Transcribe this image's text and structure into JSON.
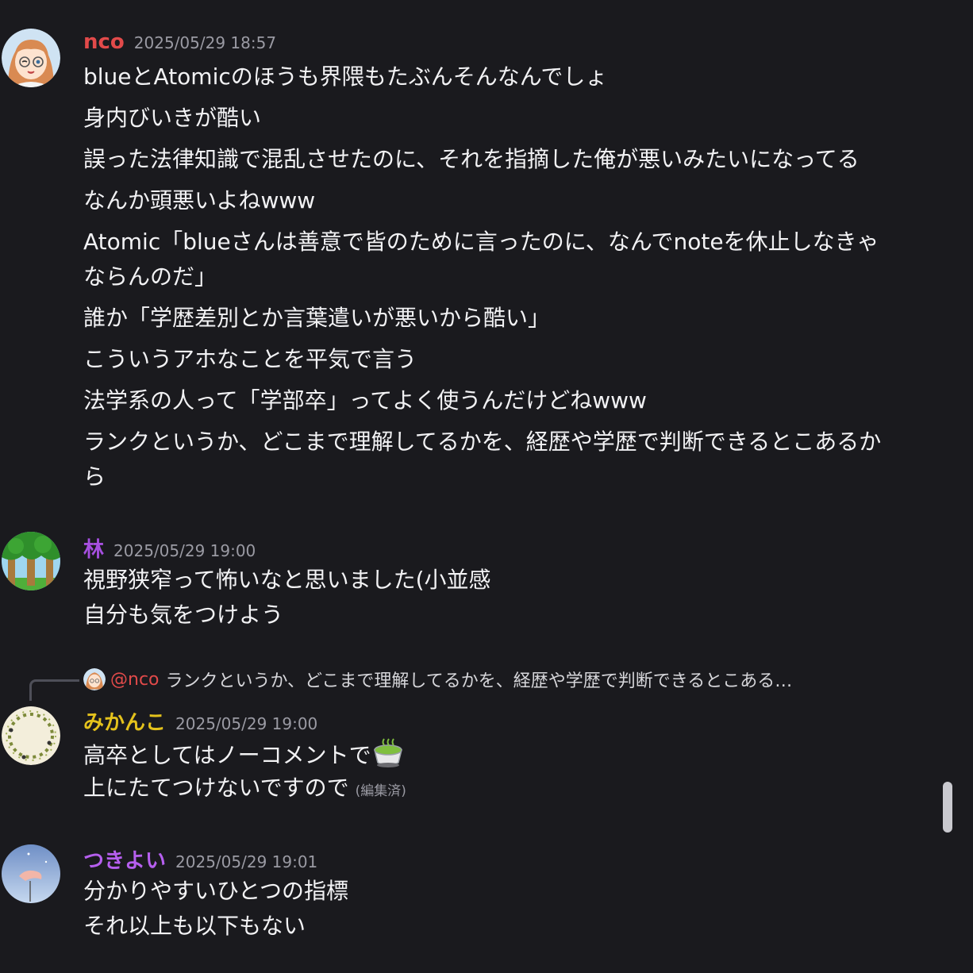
{
  "theme": {
    "background": "#1a1a1e",
    "nco_color": "#e24a4a",
    "hayashi_color": "#a64fe0",
    "mikanko_color": "#e4c21c",
    "tsukiyoi_color": "#b65fef"
  },
  "messages": [
    {
      "author": "nco",
      "timestamp": "2025/05/29 18:57",
      "avatar": "anime-girl-glasses-avatar",
      "lines": [
        "blueとAtomicのほうも界隈もたぶんそんなんでしょ",
        "身内びいきが酷い",
        "誤った法律知識で混乱させたのに、それを指摘した俺が悪いみたいになってる",
        "なんか頭悪いよねwww",
        "Atomic「blueさんは善意で皆のために言ったのに、なんでnoteを休止しなきゃならんのだ」",
        "誰か「学歴差別とか言葉遣いが悪いから酷い」",
        "こういうアホなことを平気で言う",
        "法学系の人って「学部卒」ってよく使うんだけどねwww",
        "ランクというか、どこまで理解してるかを、経歴や学歴で判断できるとこあるから"
      ]
    },
    {
      "author": "林",
      "timestamp": "2025/05/29 19:00",
      "avatar": "forest-avatar",
      "lines": [
        "視野狭窄って怖いなと思いました(小並感",
        "自分も気をつけよう"
      ]
    },
    {
      "reply": {
        "mention": "@nco",
        "text": "ランクというか、どこまで理解してるかを、経歴や学歴で判断できるとこある…"
      },
      "author": "みかんこ",
      "timestamp": "2025/05/29 19:00",
      "avatar": "leaf-wreath-avatar",
      "lines": [
        "高卒としてはノーコメントで",
        "上にたてつけないですので"
      ],
      "emoji": "tea-cup-emoji",
      "edited_label": "(編集済)"
    },
    {
      "author": "つきよい",
      "timestamp": "2025/05/29 19:01",
      "avatar": "moon-night-avatar",
      "lines": [
        "分かりやすいひとつの指標",
        "それ以上も以下もない"
      ]
    }
  ]
}
